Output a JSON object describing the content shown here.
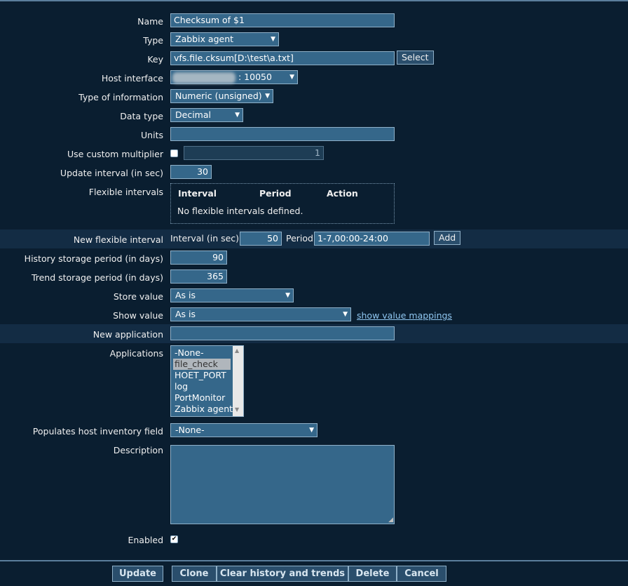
{
  "form": {
    "name": {
      "label": "Name",
      "value": "Checksum of $1"
    },
    "type": {
      "label": "Type",
      "value": "Zabbix agent"
    },
    "key": {
      "label": "Key",
      "value": "vfs.file.cksum[D:\\test\\a.txt]",
      "select_button": "Select"
    },
    "host_interface": {
      "label": "Host interface",
      "value": ": 10050"
    },
    "type_of_information": {
      "label": "Type of information",
      "value": "Numeric (unsigned)"
    },
    "data_type": {
      "label": "Data type",
      "value": "Decimal"
    },
    "units": {
      "label": "Units",
      "value": ""
    },
    "custom_multiplier": {
      "label": "Use custom multiplier",
      "value": "1",
      "checked": false
    },
    "update_interval": {
      "label": "Update interval (in sec)",
      "value": "30"
    },
    "flexible_intervals": {
      "label": "Flexible intervals",
      "columns": [
        "Interval",
        "Period",
        "Action"
      ],
      "empty_text": "No flexible intervals defined."
    },
    "new_flexible_interval": {
      "label": "New flexible interval",
      "interval_label": "Interval (in sec)",
      "interval_value": "50",
      "period_label": "Period",
      "period_value": "1-7,00:00-24:00",
      "add_button": "Add"
    },
    "history_storage": {
      "label": "History storage period (in days)",
      "value": "90"
    },
    "trend_storage": {
      "label": "Trend storage period (in days)",
      "value": "365"
    },
    "store_value": {
      "label": "Store value",
      "value": "As is"
    },
    "show_value": {
      "label": "Show value",
      "value": "As is",
      "link": "show value mappings"
    },
    "new_application": {
      "label": "New application",
      "value": ""
    },
    "applications": {
      "label": "Applications",
      "items": [
        "-None-",
        "file_check",
        "HOET_PORT",
        "log",
        "PortMonitor",
        "Zabbix agent"
      ],
      "selected": "file_check"
    },
    "inventory_field": {
      "label": "Populates host inventory field",
      "value": "-None-"
    },
    "description": {
      "label": "Description",
      "value": ""
    },
    "enabled": {
      "label": "Enabled",
      "checked": true
    }
  },
  "footer": {
    "update": "Update",
    "clone": "Clone",
    "clear": "Clear history and trends",
    "delete": "Delete",
    "cancel": "Cancel"
  },
  "colors": {
    "background": "#0a1e30",
    "field": "#35678a",
    "highlight_row": "#132c44",
    "link": "#8fc6f0"
  }
}
